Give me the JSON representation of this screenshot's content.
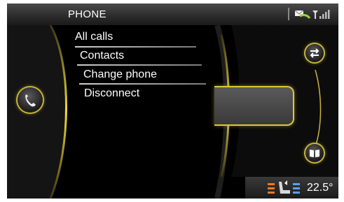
{
  "header": {
    "title": "PHONE",
    "icons": [
      "message-icon",
      "signal-strength-icon"
    ]
  },
  "menu": {
    "items": [
      {
        "label": "All calls"
      },
      {
        "label": "Contacts"
      },
      {
        "label": "Change phone"
      },
      {
        "label": "Disconnect"
      }
    ]
  },
  "left_knob": {
    "icon": "phone-handset-icon"
  },
  "right_knobs": [
    {
      "icon": "swap-arrows-icon"
    },
    {
      "icon": "book-icon"
    }
  ],
  "climate": {
    "icon": "seat-heating-icon",
    "temperature": "22.5°"
  },
  "colors": {
    "accent": "#d9c93a",
    "background": "#000000",
    "text": "#ffffff"
  }
}
